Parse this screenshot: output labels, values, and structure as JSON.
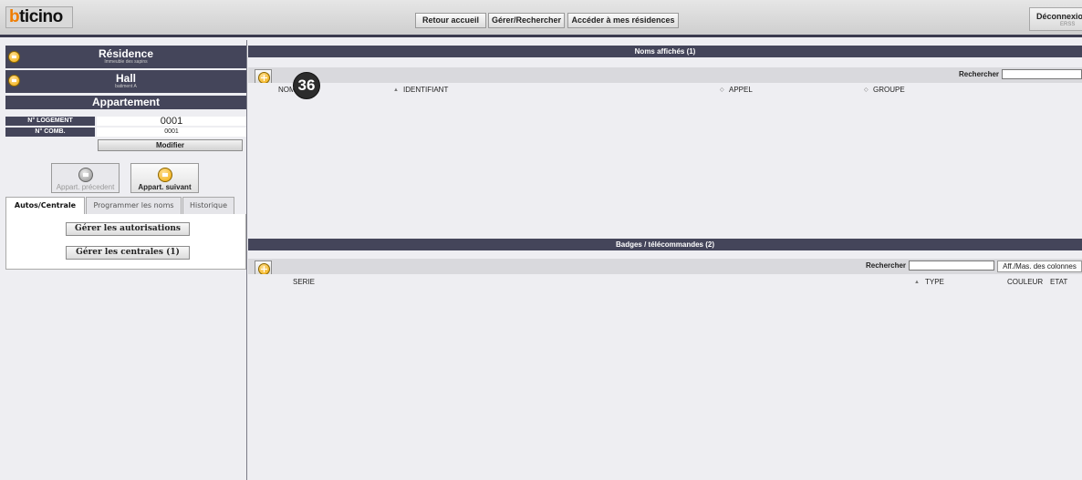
{
  "header": {
    "logo_text": "bticino",
    "nav": [
      "Retour accueil",
      "Gérer/Rechercher",
      "Accéder à mes résidences"
    ],
    "logout_label": "Déconnexion",
    "logout_sub": "ERSS"
  },
  "sidebar": {
    "residence": {
      "title": "Résidence",
      "subtitle": "Immeuble des sapins"
    },
    "hall": {
      "title": "Hall",
      "subtitle": "batiment A"
    },
    "apartment": {
      "title": "Appartement",
      "fields": [
        {
          "label": "N° LOGEMENT",
          "value": "0001"
        },
        {
          "label": "N° COMB.",
          "value": "0001"
        }
      ],
      "modify_label": "Modifier"
    },
    "prev_label": "Appart. précedent",
    "next_label": "Appart. suivant",
    "tabs": [
      "Autos/Centrale",
      "Programmer les noms",
      "Historique"
    ],
    "active_tab": "Autos/Centrale",
    "actions": [
      "Gérer les autorisations",
      "Gérer les centrales (1)"
    ]
  },
  "names_section": {
    "title": "Noms affichés (1)",
    "search_label": "Rechercher",
    "search_value": "",
    "columns": [
      "NOM",
      "IDENTIFIANT",
      "APPEL",
      "GROUPE"
    ],
    "callout": "36"
  },
  "badges_section": {
    "title": "Badges / télécommandes (2)",
    "search_label": "Rechercher",
    "search_value": "",
    "toggle_columns_label": "Aff./Mas. des colonnes",
    "columns": [
      "SERIE",
      "TYPE",
      "COULEUR",
      "ETAT"
    ]
  },
  "colors": {
    "header_bar": "#44455a",
    "accent_orange": "#f0a800",
    "background": "#eeeef2"
  }
}
